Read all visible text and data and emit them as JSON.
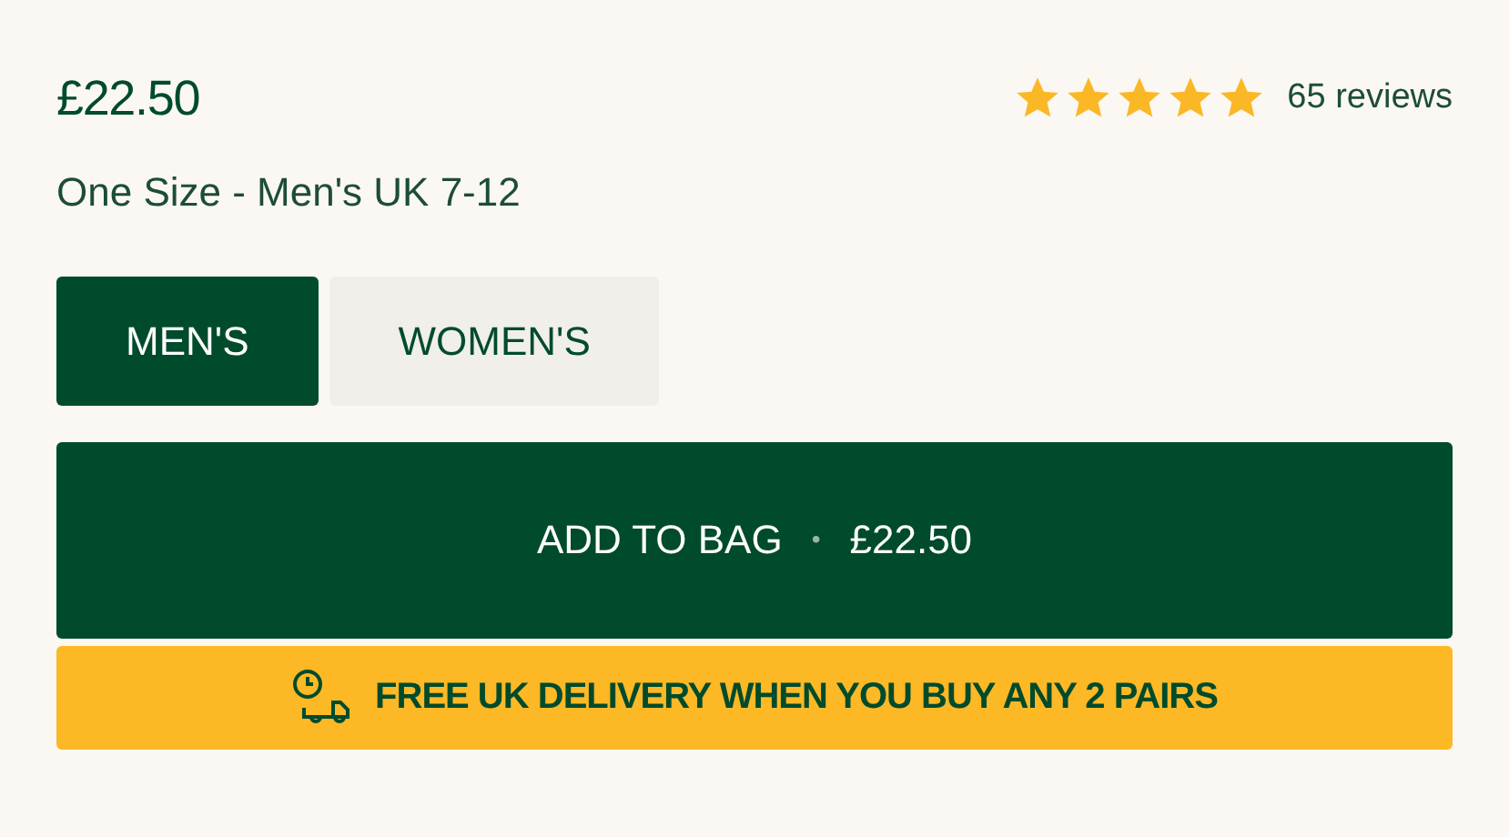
{
  "price": "£22.50",
  "rating": {
    "stars": 5,
    "reviews": "65 reviews"
  },
  "size": "One Size - Men's UK 7-12",
  "options": [
    {
      "label": "MEN'S",
      "selected": true
    },
    {
      "label": "WOMEN'S",
      "selected": false
    }
  ],
  "add_button": {
    "label": "ADD TO BAG",
    "separator": "•",
    "price": "£22.50"
  },
  "banner": "FREE UK DELIVERY WHEN YOU BUY ANY 2 PAIRS"
}
